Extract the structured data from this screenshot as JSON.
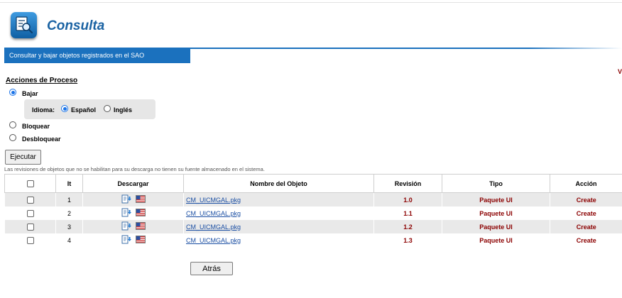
{
  "header": {
    "title": "Consulta",
    "app_icon": "search-document-icon"
  },
  "tabbar": {
    "tab_label": "Consultar y bajar objetos registrados en el SAO",
    "cut_label": "V"
  },
  "process": {
    "section_title": "Acciones de Proceso",
    "bajar_label": "Bajar",
    "bajar_checked": true,
    "idioma_label": "Idioma:",
    "espanol_label": "Español",
    "espanol_checked": true,
    "ingles_label": "Inglés",
    "bloquear_label": "Bloquear",
    "desbloquear_label": "Desbloquear",
    "ejecutar_label": "Ejecutar"
  },
  "note": "Las revisiones de objetos que no se habilitan para su descarga no tienen su fuente almacenado en el sistema.",
  "table": {
    "headers": {
      "it": "It",
      "descargar": "Descargar",
      "nombre": "Nombre del Objeto",
      "revision": "Revisión",
      "tipo": "Tipo",
      "accion": "Acción"
    },
    "rows": [
      {
        "it": "1",
        "nombre": "CM_UICMGAL.pkg",
        "revision": "1.0",
        "tipo": "Paquete UI",
        "accion": "Create"
      },
      {
        "it": "2",
        "nombre": "CM_UICMGAL.pkg",
        "revision": "1.1",
        "tipo": "Paquete UI",
        "accion": "Create"
      },
      {
        "it": "3",
        "nombre": "CM_UICMGAL.pkg",
        "revision": "1.2",
        "tipo": "Paquete UI",
        "accion": "Create"
      },
      {
        "it": "4",
        "nombre": "CM_UICMGAL.pkg",
        "revision": "1.3",
        "tipo": "Paquete UI",
        "accion": "Create"
      }
    ]
  },
  "footer": {
    "back_label": "Atrás"
  },
  "colors": {
    "accent_blue": "#1b71be",
    "title_blue": "#1b63a3",
    "dark_red": "#8b0000",
    "link_blue": "#1a4ea3"
  }
}
